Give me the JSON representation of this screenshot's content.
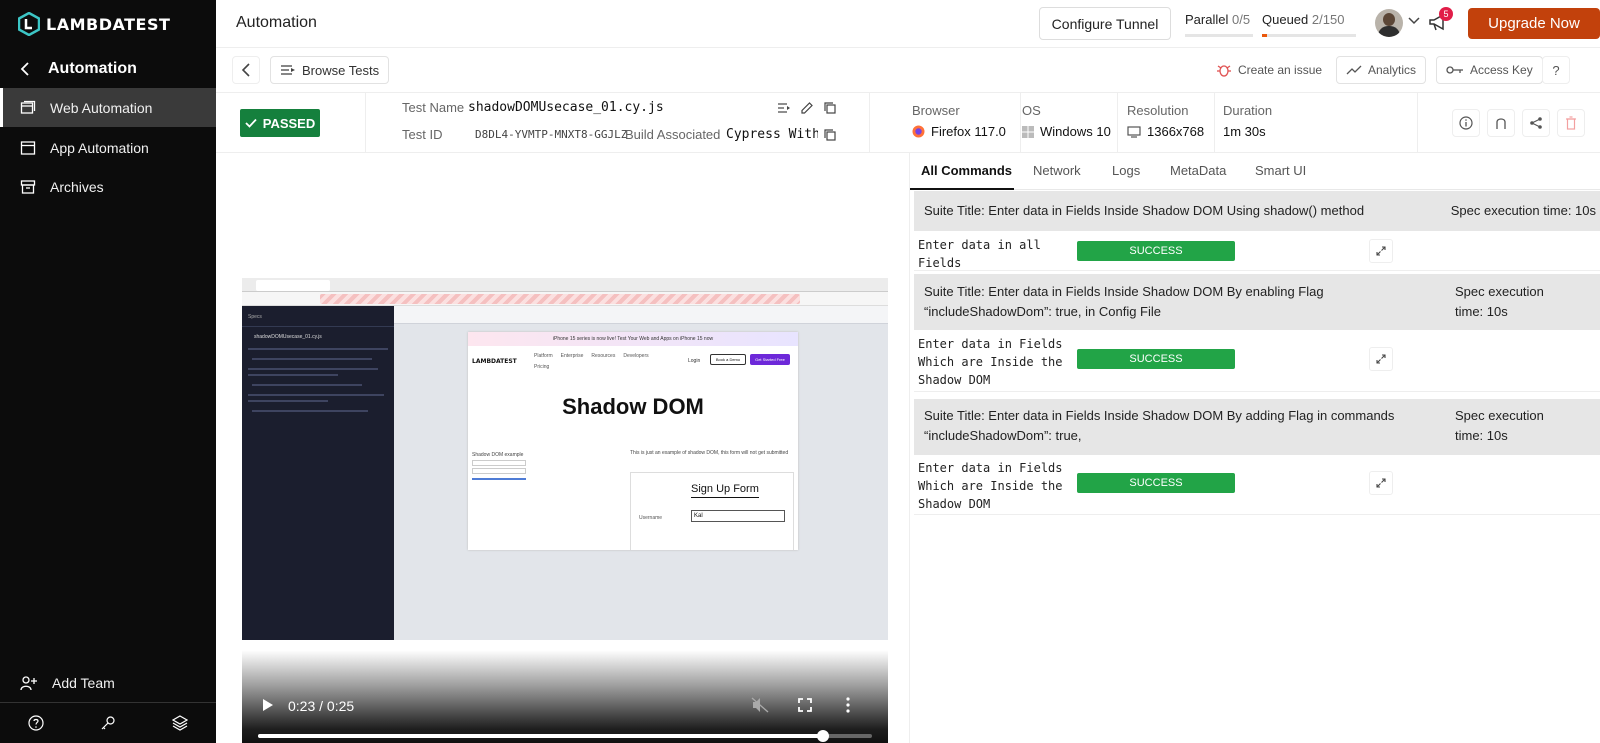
{
  "sidebar": {
    "brand": "LAMBDATEST",
    "back_label": "Automation",
    "items": [
      {
        "label": "Web Automation",
        "icon": "web-automation-icon",
        "active": true
      },
      {
        "label": "App Automation",
        "icon": "app-automation-icon",
        "active": false
      },
      {
        "label": "Archives",
        "icon": "archive-icon",
        "active": false
      }
    ],
    "add_team": "Add Team"
  },
  "header": {
    "title": "Automation",
    "configure_tunnel": "Configure Tunnel",
    "parallel_label": "Parallel",
    "parallel_value": "0/5",
    "queued_label": "Queued",
    "queued_value": "2/150",
    "notification_count": "5",
    "upgrade": "Upgrade Now"
  },
  "toolbar": {
    "browse_tests": "Browse Tests",
    "create_issue": "Create an issue",
    "analytics": "Analytics",
    "access_key": "Access Key",
    "help": "?"
  },
  "test": {
    "status": "PASSED",
    "name_label": "Test Name",
    "name": "shadowDOMUsecase_01.cy.js",
    "id_label": "Test ID",
    "id": "D8DL4-YVMTP-MNXT8-GGJLZ",
    "build_label": "Build Associated",
    "build": "Cypress With…",
    "browser_label": "Browser",
    "browser": "Firefox 117.0",
    "os_label": "OS",
    "os": "Windows 10",
    "resolution_label": "Resolution",
    "resolution": "1366x768",
    "duration_label": "Duration",
    "duration": "1m 30s"
  },
  "video": {
    "time": "0:23 / 0:25",
    "progress": 0.92,
    "page_heading": "Shadow DOM",
    "form_title": "Sign Up Form",
    "username_label": "Username",
    "username_value": "Kal",
    "login": "Login",
    "book_demo": "Book a Demo",
    "get_started": "Get Started Free",
    "shadow_example": "Shadow DOM example",
    "note": "This is just an example of shadow DOM, this form will not get submitted",
    "spec_file": "shadowDOMUsecase_01.cy.js",
    "banner": "iPhone 15 series is now live! Test Your Web and Apps on iPhone 15 now",
    "specs_label": "Specs",
    "nav": [
      "Platform",
      "Enterprise",
      "Resources",
      "Developers",
      "Pricing"
    ]
  },
  "tabs": [
    "All Commands",
    "Network",
    "Logs",
    "MetaData",
    "Smart UI"
  ],
  "commands": [
    {
      "suite_title": "Suite Title: Enter data in Fields Inside Shadow DOM Using shadow() method",
      "spec_time": "Spec execution time: 10s",
      "command": "Enter data in all Fields",
      "status": "SUCCESS"
    },
    {
      "suite_title": "Suite Title: Enter data in Fields Inside Shadow DOM By enabling Flag “includeShadowDom”: true, in Config File",
      "spec_time": "Spec execution time: 10s",
      "command": "Enter data in Fields Which are Inside the Shadow DOM",
      "status": "SUCCESS"
    },
    {
      "suite_title": "Suite Title: Enter data in Fields Inside Shadow DOM By adding Flag in commands “includeShadowDom”: true,",
      "spec_time": "Spec execution time: 10s",
      "command": "Enter data in Fields Which are Inside the Shadow DOM",
      "status": "SUCCESS"
    }
  ]
}
